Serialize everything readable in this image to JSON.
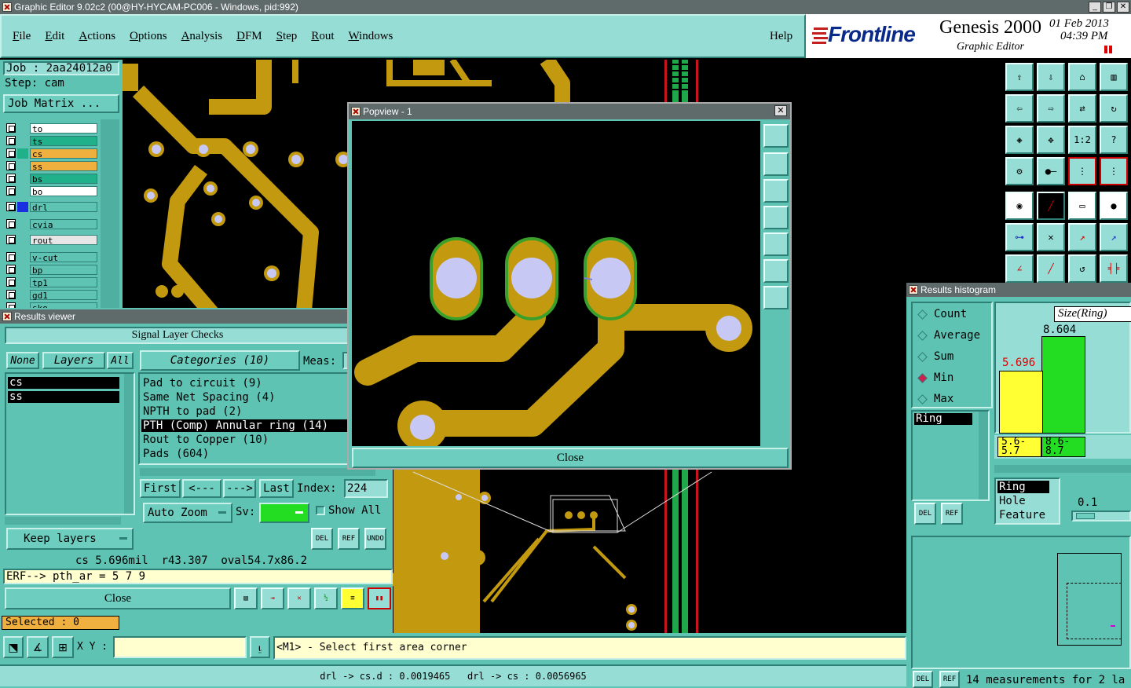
{
  "window": {
    "title": "Graphic Editor 9.02c2 (00@HY-HYCAM-PC006 - Windows, pid:992)"
  },
  "menu": [
    "File",
    "Edit",
    "Actions",
    "Options",
    "Analysis",
    "DFM",
    "Step",
    "Rout",
    "Windows"
  ],
  "help": "Help",
  "brand": {
    "logo": "Frontline",
    "product": "Genesis 2000",
    "subtitle": "Graphic Editor",
    "date": "01 Feb 2013",
    "time": "04:39 PM"
  },
  "job": {
    "job_label": "Job : 2aa24012a0",
    "step_label": "Step: cam",
    "matrix_button": "Job Matrix ..."
  },
  "layers": [
    {
      "name": "to",
      "color": "#ffffff"
    },
    {
      "name": "ts",
      "color": "#20b08a"
    },
    {
      "name": "cs",
      "color": "#f0b040"
    },
    {
      "name": "ss",
      "color": "#f0b040"
    },
    {
      "name": "bs",
      "color": "#20b08a"
    },
    {
      "name": "bo",
      "color": "#ffffff"
    },
    {
      "name": "drl",
      "color": "#5fc3b4"
    },
    {
      "name": "cvia",
      "color": "#5fc3b4"
    },
    {
      "name": "rout",
      "color": "#e6e6e6"
    },
    {
      "name": "v-cut",
      "color": "#5fc3b4"
    },
    {
      "name": "bp",
      "color": "#5fc3b4"
    },
    {
      "name": "tp1",
      "color": "#5fc3b4"
    },
    {
      "name": "gd1",
      "color": "#5fc3b4"
    },
    {
      "name": "sko",
      "color": "#5fc3b4"
    }
  ],
  "results_viewer": {
    "title": "Results viewer",
    "heading": "Signal Layer Checks",
    "none_btn": "None",
    "layers_btn": "Layers",
    "all_btn": "All",
    "layers_list": [
      "cs",
      "ss"
    ],
    "categories_btn": "Categories (10)",
    "meas_label": "Meas:",
    "categories": [
      "Pad to circuit (9)",
      "Same Net Spacing (4)",
      "NPTH to pad (2)",
      "PTH (Comp) Annular ring (14)",
      "Rout to Copper (10)",
      "Pads (604)"
    ],
    "selected_category": 3,
    "first": "First",
    "prev": "<---",
    "next": "--->",
    "last": "Last",
    "index_label": "Index:",
    "index_value": "224",
    "auto_zoom": "Auto Zoom",
    "sv_label": "Sv:",
    "show_all": "Show All",
    "keep_layers": "Keep layers",
    "del": "DEL",
    "ref": "REF",
    "undo": "UNDO",
    "info_line": "cs 5.696mil  r43.307  oval54.7x86.2",
    "erf_line": "ERF--> pth_ar = 5 7 9",
    "close": "Close"
  },
  "selected": "Selected : 0",
  "coord": {
    "label": "X Y :",
    "value": ""
  },
  "prompt": "<M1> - Select first area corner",
  "status": "drl -> cs.d : 0.0019465   drl -> cs : 0.0056965",
  "popview": {
    "title": "Popview - 1",
    "close": "Close"
  },
  "histogram": {
    "title": "Results histogram",
    "options": [
      "Count",
      "Average",
      "Sum",
      "Min",
      "Max"
    ],
    "selected_option": "Min",
    "list": [
      "Ring"
    ],
    "chart_title": "Size(Ring)",
    "bars": [
      {
        "value": "5.696",
        "range": "5.6-5.7",
        "color": "#ffff33",
        "label_color": "#e00000"
      },
      {
        "value": "8.604",
        "range": "8.6-8.7",
        "color": "#22dd22",
        "label_color": "#000000"
      }
    ],
    "type_list": [
      "Ring",
      "Hole",
      "Feature"
    ],
    "scale_value": "0.1",
    "measurements": "14 measurements for 2 la"
  }
}
